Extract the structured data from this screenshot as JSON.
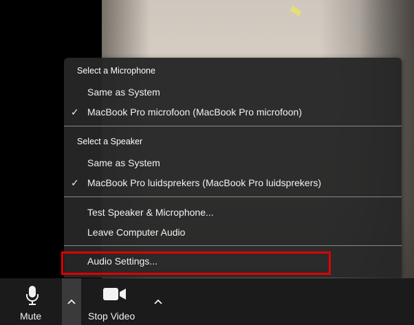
{
  "menu": {
    "microphone_header": "Select a Microphone",
    "microphone_options": [
      {
        "label": "Same as System",
        "checked": false
      },
      {
        "label": "MacBook Pro microfoon (MacBook Pro microfoon)",
        "checked": true
      }
    ],
    "speaker_header": "Select a Speaker",
    "speaker_options": [
      {
        "label": "Same as System",
        "checked": false
      },
      {
        "label": "MacBook Pro luidsprekers (MacBook Pro luidsprekers)",
        "checked": true
      }
    ],
    "test_label": "Test Speaker & Microphone...",
    "leave_label": "Leave Computer Audio",
    "settings_label": "Audio Settings...",
    "check_glyph": "✓"
  },
  "toolbar": {
    "mute_label": "Mute",
    "stop_video_label": "Stop Video"
  },
  "colors": {
    "highlight": "#e00000",
    "menu_bg": "#262626",
    "toolbar_bg": "#1b1b1b"
  },
  "icons": [
    "microphone-icon",
    "chevron-up-icon",
    "video-camera-icon",
    "checkmark-icon"
  ]
}
